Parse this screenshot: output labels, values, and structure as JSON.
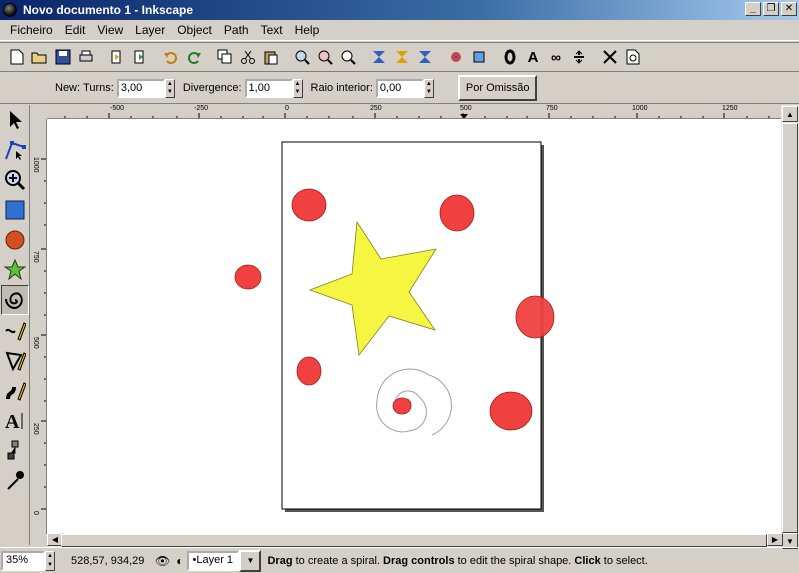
{
  "window": {
    "title": "Novo documento 1 - Inkscape",
    "controls": [
      "_",
      "❐",
      "✕"
    ]
  },
  "menubar": {
    "items": [
      {
        "label": "Ficheiro",
        "key": "F"
      },
      {
        "label": "Edit",
        "key": "E"
      },
      {
        "label": "View",
        "key": "V"
      },
      {
        "label": "Layer",
        "key": "L"
      },
      {
        "label": "Object",
        "key": "O"
      },
      {
        "label": "Path",
        "key": "P"
      },
      {
        "label": "Text",
        "key": "T"
      },
      {
        "label": "Help",
        "key": "H"
      }
    ]
  },
  "toolbar": {
    "icons": [
      "new-document-icon",
      "open-icon",
      "save-icon",
      "print-icon",
      "import-icon",
      "export-icon",
      "undo-icon",
      "redo-icon",
      "duplicate-icon",
      "cut-icon",
      "paste-icon",
      "zoom-selection-icon",
      "zoom-drawing-icon",
      "zoom-page-icon",
      "align-left-icon",
      "align-center-icon",
      "align-right-icon",
      "fill-stroke-icon",
      "transform-icon",
      "stroke-icon",
      "text-font-icon",
      "clone-icon",
      "group-icon",
      "preferences-icon",
      "document-properties-icon"
    ]
  },
  "tool_controls": {
    "new_label": "New:",
    "turns_label": "Turns:",
    "turns_value": "3,00",
    "divergence_label": "Divergence:",
    "divergence_value": "1,00",
    "inner_radius_label": "Raio interior:",
    "inner_radius_value": "0,00",
    "default_button": "Por Omissão"
  },
  "toolbox": {
    "tools": [
      {
        "name": "selector-tool-icon",
        "active": false
      },
      {
        "name": "node-tool-icon",
        "active": false
      },
      {
        "name": "zoom-tool-icon",
        "active": false
      },
      {
        "name": "rectangle-tool-icon",
        "active": false
      },
      {
        "name": "ellipse-tool-icon",
        "active": false
      },
      {
        "name": "star-tool-icon",
        "active": false
      },
      {
        "name": "spiral-tool-icon",
        "active": true
      },
      {
        "name": "pencil-tool-icon",
        "active": false
      },
      {
        "name": "pen-tool-icon",
        "active": false
      },
      {
        "name": "calligraphy-tool-icon",
        "active": false
      },
      {
        "name": "text-tool-icon",
        "active": false
      },
      {
        "name": "connector-tool-icon",
        "active": false
      },
      {
        "name": "dropper-tool-icon",
        "active": false
      }
    ]
  },
  "rulers": {
    "horizontal_ticks": [
      "-500",
      "-250",
      "0",
      "250",
      "500",
      "750",
      "1000",
      "1250"
    ],
    "vertical_ticks": [
      "1000",
      "750",
      "500",
      "250",
      "0"
    ]
  },
  "canvas": {
    "colors": {
      "circle_fill": "#f04040",
      "circle_stroke": "#a02020",
      "star_fill": "#f5f542",
      "star_stroke": "#808020",
      "spiral_stroke": "#a0a0a0",
      "page_border": "#000000",
      "page_shadow": "#555555"
    }
  },
  "statusbar": {
    "zoom": "35%",
    "coords": "528,57, 934,29",
    "layer": "•Layer 1",
    "message_drag1": "Drag",
    "message_text1": " to create a spiral. ",
    "message_drag2": "Drag controls",
    "message_text2": " to edit the spiral shape. ",
    "message_click": "Click",
    "message_text3": " to select."
  }
}
